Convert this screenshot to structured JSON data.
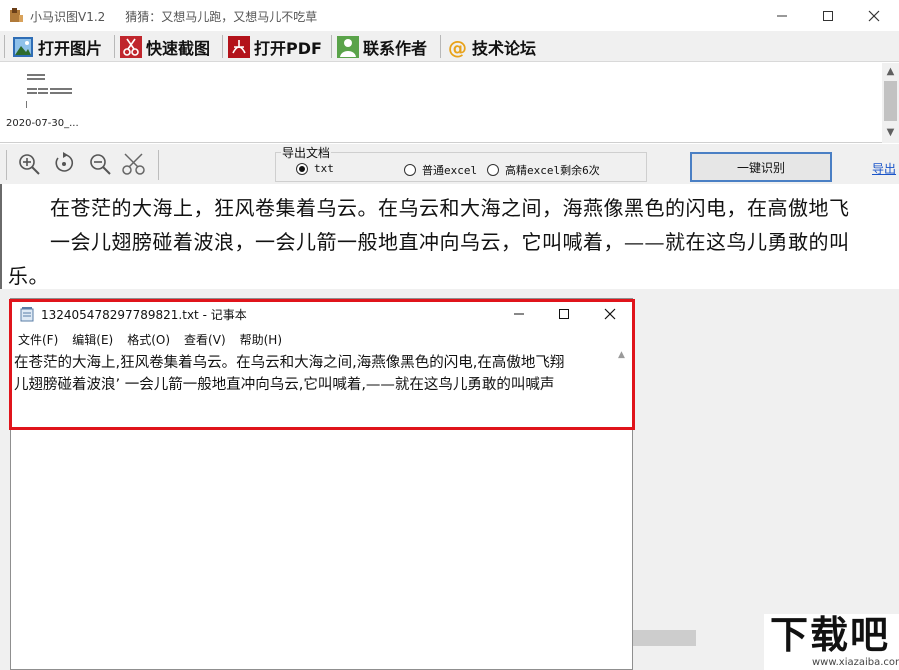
{
  "window": {
    "title": "小马识图V1.2",
    "slogan": "猜猜：又想马儿跑，又想马儿不吃草"
  },
  "toolbar": {
    "items": [
      {
        "label": "打开图片",
        "icon": "picture-icon"
      },
      {
        "label": "快速截图",
        "icon": "scissors-icon"
      },
      {
        "label": "打开PDF",
        "icon": "pdf-icon"
      },
      {
        "label": "联系作者",
        "icon": "person-icon"
      },
      {
        "label": "技术论坛",
        "icon": "at-icon"
      }
    ]
  },
  "thumbnail": {
    "label": "2020-07-30_..."
  },
  "controls": {
    "tools": [
      "zoom-in-icon",
      "rotate-icon",
      "zoom-out-icon",
      "crop-scissors-icon"
    ],
    "export_group_label": "导出文档",
    "options": [
      {
        "label": "txt",
        "selected": true
      },
      {
        "label": "普通excel",
        "selected": false
      },
      {
        "label": "高精excel剩余6次",
        "selected": false
      }
    ],
    "recognize_button": "一键识别",
    "export_link": "导出"
  },
  "result": {
    "lines": [
      "在苍茫的大海上，狂风卷集着乌云。在乌云和大海之间，海燕像黑色的闪电，在高傲地飞",
      "一会儿翅膀碰着波浪，一会儿箭一般地直冲向乌云，它叫喊着，——就在这鸟儿勇敢的叫",
      "乐。"
    ]
  },
  "notepad": {
    "title": "132405478297789821.txt - 记事本",
    "menu": [
      "文件(F)",
      "编辑(E)",
      "格式(O)",
      "查看(V)",
      "帮助(H)"
    ],
    "lines": [
      "在苍茫的大海上,狂风卷集着乌云。在乌云和大海之间,海燕像黑色的闪电,在高傲地飞翔",
      "儿翅膀碰着波浪’ 一会儿箭一般地直冲向乌云,它叫喊着,——就在这鸟儿勇敢的叫喊声"
    ]
  },
  "watermark": {
    "big": "下载吧",
    "url": "www.xiazaiba.com"
  },
  "colors": {
    "highlight_border": "#e0141b",
    "button_border": "#4a7fc4",
    "link": "#1a55c9"
  }
}
